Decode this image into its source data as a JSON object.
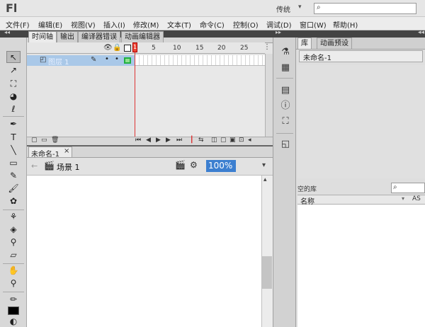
{
  "app": {
    "logo": "Fl",
    "workspace": "传统",
    "search_placeholder": ""
  },
  "menu": [
    "文件(F)",
    "编辑(E)",
    "视图(V)",
    "插入(I)",
    "修改(M)",
    "文本(T)",
    "命令(C)",
    "控制(O)",
    "调试(D)",
    "窗口(W)",
    "帮助(H)"
  ],
  "timeline": {
    "tabs": [
      "时间轴",
      "输出",
      "编译器错误",
      "动画编辑器"
    ],
    "layer_name": "图层 1",
    "ruler_numbers": [
      "5",
      "10",
      "15",
      "20",
      "25"
    ],
    "current_frame": "1"
  },
  "document": {
    "tab_label": "未命名-1",
    "close_glyph": "×",
    "scene_label": "场景 1",
    "zoom": "100%"
  },
  "library": {
    "tabs": [
      "库",
      "动画预设"
    ],
    "document_name": "未命名-1",
    "empty_text": "空的库",
    "col_name": "名称",
    "col_linkage": "AS"
  },
  "icons": {
    "search": "magnifier-icon",
    "scene": "clapperboard-icon",
    "edit_symbols": "edit-symbols-icon",
    "edit_scenes": "edit-scenes-icon"
  },
  "colors": {
    "accent": "#3c7fd0",
    "playhead": "#e43a2f",
    "layer_selected": "#a9c8e8"
  }
}
